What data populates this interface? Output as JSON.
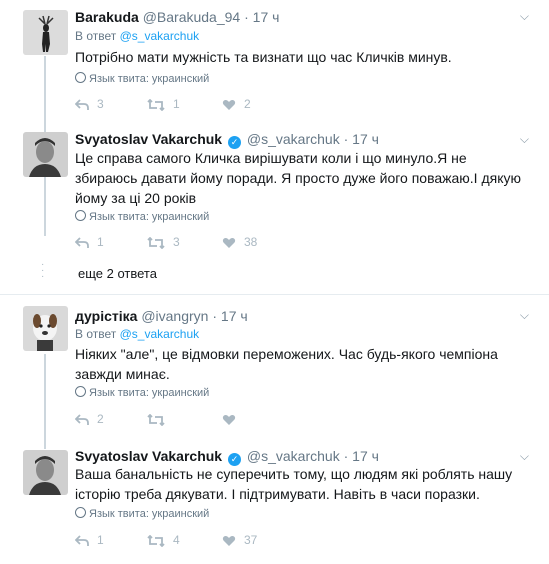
{
  "tweets": [
    {
      "name": "Barakuda",
      "handle": "@Barakuda_94",
      "time": "17 ч",
      "reply_prefix": "В ответ",
      "reply_handle": "@s_vakarchuk",
      "text": "Потрібно мати мужність та визнати що  час Кличків минув.",
      "language": "Язык твита: украинский",
      "replies": "3",
      "retweets": "1",
      "likes": "2"
    },
    {
      "name": "Svyatoslav Vakarchuk",
      "verified_icon": "verified-badge",
      "handle": "@s_vakarchuk",
      "time": "17 ч",
      "text": "Це справа самого Кличка вирішувати коли і що минуло.Я не збираюсь давати йому поради. Я просто дуже його поважаю.І дякую йому за ці 20 років",
      "language": "Язык твита: украинский",
      "replies": "1",
      "retweets": "3",
      "likes": "38"
    },
    {
      "name": "дурістіка",
      "handle": "@ivangryn",
      "time": "17 ч",
      "reply_prefix": "В ответ",
      "reply_handle": "@s_vakarchuk",
      "text": "Ніяких \"але\", це відмовки переможених. Час будь-якого чемпіона завжди минає.",
      "language": "Язык твита: украинский",
      "replies": "2",
      "retweets": "",
      "likes": ""
    },
    {
      "name": "Svyatoslav Vakarchuk",
      "verified_icon": "verified-badge",
      "handle": "@s_vakarchuk",
      "time": "17 ч",
      "text": "Ваша банальність не суперечить тому, що людям які роблять нашу історію треба дякувати. І підтримувати. Навіть в часи поразки.",
      "language": "Язык твита: украинский",
      "replies": "1",
      "retweets": "4",
      "likes": "37"
    }
  ],
  "more_replies": "еще 2 ответа",
  "separator_dot": "·",
  "colors": {
    "accent": "#1da1f2",
    "muted": "#657786",
    "icon": "#aab8c2",
    "line": "#ccd6dd"
  }
}
